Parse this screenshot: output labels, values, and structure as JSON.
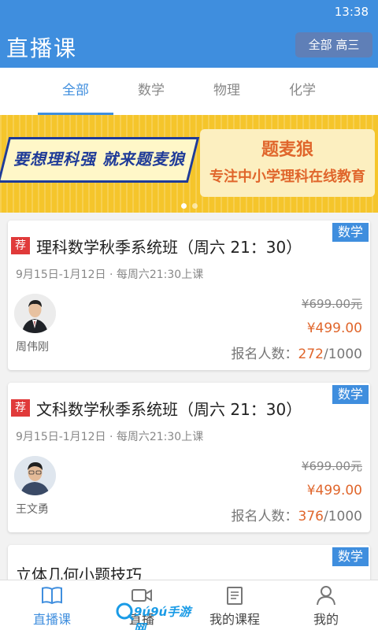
{
  "status_bar": {
    "time": "13:38"
  },
  "header": {
    "title": "直播课",
    "filter_label": "全部 高三"
  },
  "tabs": [
    {
      "label": "全部",
      "active": true
    },
    {
      "label": "数学",
      "active": false
    },
    {
      "label": "物理",
      "active": false
    },
    {
      "label": "化学",
      "active": false
    }
  ],
  "banner": {
    "slogan": "要想理科强 就来题麦狼",
    "brand": "题麦狼",
    "tagline": "专注中小学理科在线教育",
    "slide_count": 2,
    "current_slide": 1
  },
  "courses": [
    {
      "subject": "数学",
      "recommended_label": "荐",
      "title": "理科数学秋季系统班（周六 21：30）",
      "schedule": "9月15日-1月12日 · 每周六21:30上课",
      "teacher": "周伟刚",
      "original_price": "¥699.00元",
      "price": "¥499.00",
      "enroll_label": "报名人数：",
      "enrolled": "272",
      "capacity": "/1000"
    },
    {
      "subject": "数学",
      "recommended_label": "荐",
      "title": "文科数学秋季系统班（周六 21：30）",
      "schedule": "9月15日-1月12日 · 每周六21:30上课",
      "teacher": "王文勇",
      "original_price": "¥699.00元",
      "price": "¥499.00",
      "enroll_label": "报名人数：",
      "enrolled": "376",
      "capacity": "/1000"
    },
    {
      "subject": "数学",
      "title": "立体几何小题技巧"
    }
  ],
  "bottom_nav": [
    {
      "label": "直播课",
      "icon": "book-icon",
      "active": true
    },
    {
      "label": "直播",
      "icon": "video-camera-icon",
      "active": false
    },
    {
      "label": "我的课程",
      "icon": "clipboard-icon",
      "active": false
    },
    {
      "label": "我的",
      "icon": "person-icon",
      "active": false
    }
  ],
  "watermark": {
    "text": "9ú9ú手游网"
  },
  "colors": {
    "primary": "#3f8ede",
    "price": "#e0662c",
    "recommend": "#e03a3a",
    "banner_bg": "#f5c52b",
    "banner_ink": "#1f3b98"
  }
}
